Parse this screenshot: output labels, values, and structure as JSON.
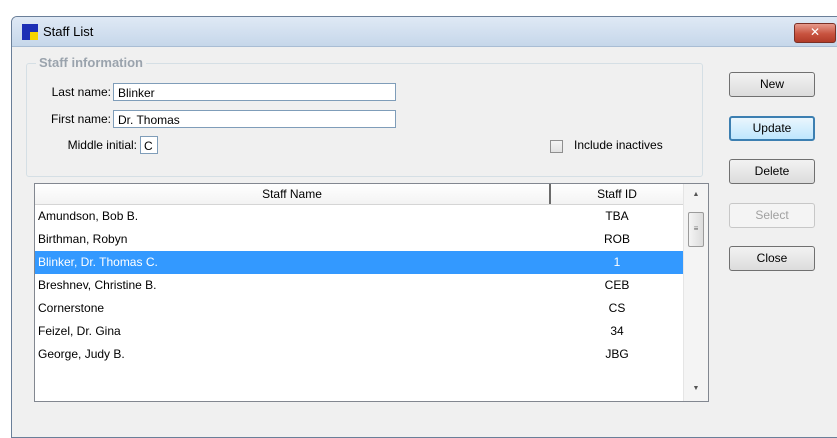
{
  "window": {
    "title": "Staff List",
    "close_label": "✕"
  },
  "staff_info": {
    "legend": "Staff information",
    "last_name_label": "Last name:",
    "last_name_value": "Blinker",
    "first_name_label": "First name:",
    "first_name_value": "Dr. Thomas",
    "middle_initial_label": "Middle initial:",
    "middle_initial_value": "C",
    "include_inactives_label": "Include inactives",
    "include_inactives_checked": false
  },
  "buttons": {
    "new": "New",
    "update": "Update",
    "delete": "Delete",
    "select": "Select",
    "close": "Close"
  },
  "list": {
    "columns": [
      "Staff Name",
      "Staff ID"
    ],
    "rows": [
      {
        "name": "Amundson, Bob  B.",
        "id": "TBA"
      },
      {
        "name": "Birthman, Robyn",
        "id": "ROB"
      },
      {
        "name": "Blinker, Dr. Thomas  C.",
        "id": "1"
      },
      {
        "name": "Breshnev, Christine  B.",
        "id": "CEB"
      },
      {
        "name": "Cornerstone",
        "id": "CS"
      },
      {
        "name": "Feizel, Dr. Gina",
        "id": "34"
      },
      {
        "name": "George, Judy  B.",
        "id": "JBG"
      }
    ]
  },
  "scrollbar": {
    "up_icon": "▲",
    "down_icon": "▼",
    "grip_icon": "≡"
  },
  "colors": {
    "selection": "#3399ff",
    "close_button": "#c8533f"
  }
}
